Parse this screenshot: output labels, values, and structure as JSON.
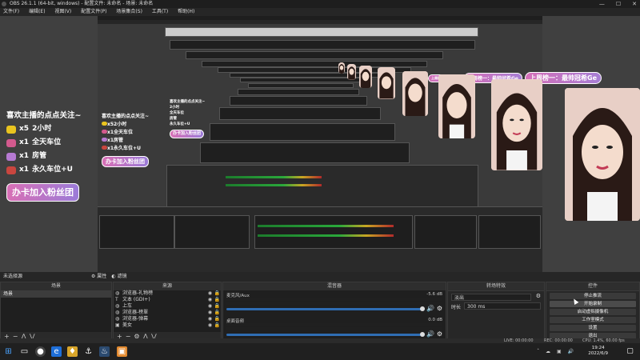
{
  "window": {
    "title": "OBS 26.1.1 (64-bit, windows) - 配置文件: 未命名 - 场景: 未命名",
    "controls": [
      "—",
      "☐",
      "✕"
    ]
  },
  "menu": [
    "文件(F)",
    "编辑(E)",
    "视图(V)",
    "配置文件(P)",
    "场景集合(S)",
    "工具(T)",
    "帮助(H)"
  ],
  "overlay": {
    "title": "喜欢主播的点点关注~",
    "gifts": [
      {
        "count": "x5",
        "text": "2小时",
        "color": "#e9c41f"
      },
      {
        "count": "x1",
        "text": "全天车位",
        "color": "#d35a8e"
      },
      {
        "count": "x1",
        "text": "房管",
        "color": "#b67ad2"
      },
      {
        "count": "x1",
        "text": "永久车位+U",
        "color": "#c9463f"
      }
    ],
    "join": "办卡加入粉丝团",
    "rank": "上周榜一：最帅冠希Ge",
    "rank_small": "上周榜一：最帅冠希Ge"
  },
  "statusbar_top": {
    "left": "未选择源",
    "props": "属性",
    "filters": "滤镜"
  },
  "scenes": {
    "header": "场景",
    "items": [
      "场景"
    ]
  },
  "sources": {
    "header": "来源",
    "items": [
      {
        "icon": "globe",
        "name": "浏览器-礼物榜"
      },
      {
        "icon": "text",
        "name": "文本 (GDI+)"
      },
      {
        "icon": "globe",
        "name": "上车"
      },
      {
        "icon": "globe",
        "name": "浏览器-榜單"
      },
      {
        "icon": "globe",
        "name": "浏览器-弹幕"
      },
      {
        "icon": "camera",
        "name": "美女"
      }
    ]
  },
  "mixer": {
    "header": "混音器",
    "channels": [
      {
        "name": "麦克风/Aux",
        "db": "-5.6 dB"
      },
      {
        "name": "桌面音频",
        "db": "0.0 dB"
      }
    ]
  },
  "transitions": {
    "header": "转场特效",
    "type": "淡出",
    "duration_label": "时长",
    "duration": "300 ms"
  },
  "controls": {
    "header": "控件",
    "buttons": [
      "停止推流",
      "开始录制",
      "启动虚拟摄像机",
      "工作室模式",
      "设置",
      "退出"
    ]
  },
  "bottom_status": {
    "live": "LIVE: 00:00:00",
    "rec": "REC: 00:00:00",
    "cpu": "CPU: 1.4%, 60.00 fps"
  },
  "taskbar": {
    "time": "19:24",
    "date": "2022/6/9"
  }
}
